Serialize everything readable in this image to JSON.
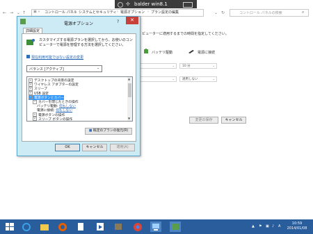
{
  "remote_bar": {
    "title": "balder win8.1"
  },
  "address": {
    "breadcrumbs": [
      "コントロール パネル",
      "システムとセキュリティ",
      "電源オプション",
      "プラン設定の編集"
    ],
    "search_placeholder": "コントロール パネルの検索"
  },
  "background": {
    "description": "ピューターに適用するまでの時間を指定してください。",
    "col_battery": "バッテリ駆動",
    "col_plugged": "電源に接続",
    "sleep_value": "10 分",
    "never_value": "適用しない",
    "save_btn": "変更の保存",
    "cancel_btn": "キャンセル"
  },
  "dialog": {
    "title": "電源オプション",
    "help": "?",
    "close": "✕",
    "tab": "詳細設定",
    "description": "カスタマイズする電源プランを選択してから、お使いのコンピューターで電源を管理する方法を選択してください。",
    "link": "現在利用可能ではない設定の変更",
    "plan_selected": "バランス [アクティブ]",
    "tree": [
      {
        "label": "デスクトップの背景の設定",
        "level": 0,
        "expander": "+",
        "selected": false
      },
      {
        "label": "ワイヤレス アダプターの設定",
        "level": 0,
        "expander": "+",
        "selected": false
      },
      {
        "label": "スリープ",
        "level": 0,
        "expander": "+",
        "selected": false
      },
      {
        "label": "USB 設定",
        "level": 0,
        "expander": "+",
        "selected": false
      },
      {
        "label": "電源ボタンとカバー",
        "level": 0,
        "expander": "−",
        "selected": true
      },
      {
        "label": "カバーを閉じたときの操作",
        "level": 1,
        "expander": "−",
        "selected": false
      },
      {
        "label": "バッテリ駆動: ",
        "level": 2,
        "link": "何もしない",
        "selected": false
      },
      {
        "label": "電源に接続: ",
        "level": 2,
        "link": "何もしない",
        "selected": false
      },
      {
        "label": "電源ボタンの操作",
        "level": 1,
        "expander": "+",
        "selected": false
      },
      {
        "label": "スリープ ボタンの操作",
        "level": 1,
        "expander": "+",
        "selected": false
      }
    ],
    "restore_btn": "既定のプランの復元(R)",
    "ok": "OK",
    "cancel": "キャンセル",
    "apply": "適用(A)"
  },
  "taskbar": {
    "time": "10:59",
    "date": "2014/01/08",
    "ime": "A"
  }
}
